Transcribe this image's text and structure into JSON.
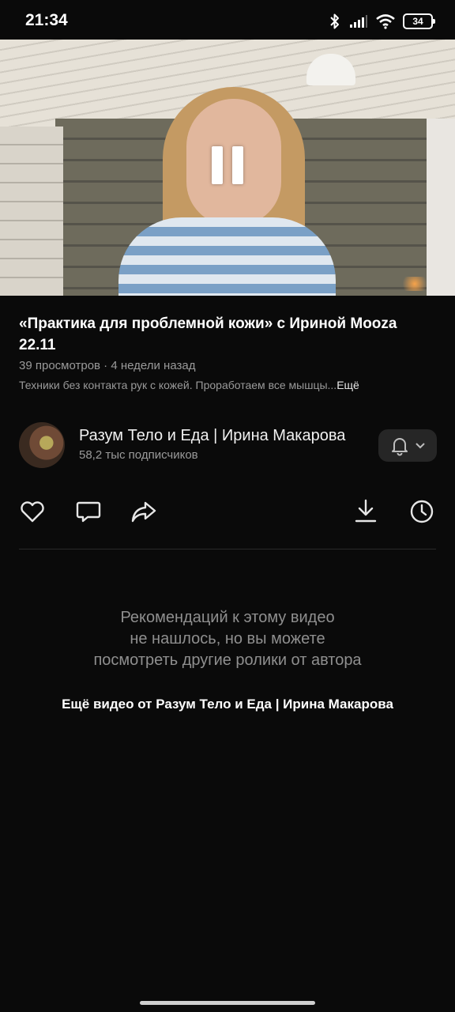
{
  "status_bar": {
    "time": "21:34",
    "battery": "34",
    "icons": [
      "bluetooth-icon",
      "signal-icon",
      "wifi-icon",
      "battery-icon"
    ]
  },
  "video": {
    "state": "playing",
    "control_icon": "pause-icon"
  },
  "info": {
    "title": "«Практика для проблемной кожи» с Ириной Mooza 22.11",
    "meta": "39 просмотров · 4 недели назад",
    "description": "Техники без контакта рук с кожей. Проработаем все мышцы...",
    "more_label": "Ещё"
  },
  "channel": {
    "name": "Разум Тело и Еда | Ирина Макарова",
    "subscribers": "58,2 тыс подписчиков",
    "bell_icon": "bell-icon"
  },
  "actions": [
    "heart-icon",
    "comment-icon",
    "share-icon",
    "download-icon",
    "clock-icon"
  ],
  "recommendations": {
    "empty_line1": "Рекомендаций к этому видео",
    "empty_line2": "не нашлось, но вы можете",
    "empty_line3": "посмотреть другие ролики от автора",
    "more_videos": "Ещё видео от Разум Тело и Еда | Ирина Макарова"
  },
  "colors": {
    "background": "#0a0a0a",
    "primary_text": "#ffffff",
    "secondary_text": "#9a9a9a",
    "button_bg": "#262626"
  }
}
